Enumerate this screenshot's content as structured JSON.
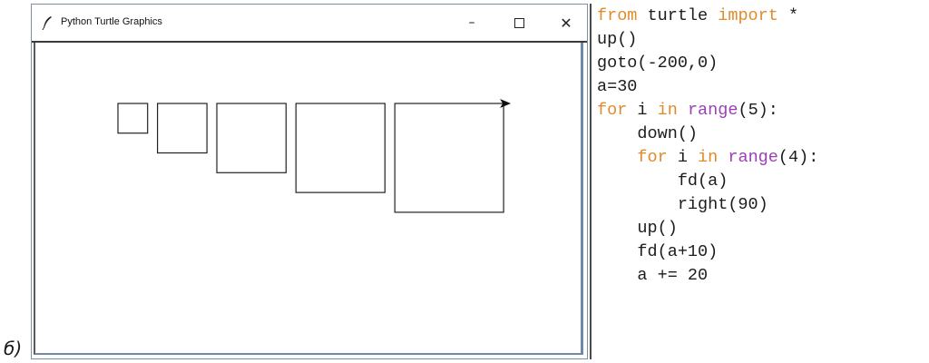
{
  "figure_label": "б)",
  "window": {
    "title": "Python Turtle Graphics",
    "feather_icon": "feather-icon",
    "minimize_label": "–",
    "close_label": "✕"
  },
  "squares": [
    {
      "side": 30
    },
    {
      "side": 50
    },
    {
      "side": 70
    },
    {
      "side": 90
    },
    {
      "side": 110
    }
  ],
  "colors": {
    "keyword": "#e08a2c",
    "builtin": "#9b3fb5",
    "text": "#1c1c1c",
    "window_border": "#7a8ea6"
  },
  "code": {
    "lines": [
      [
        {
          "t": "from",
          "c": "kw"
        },
        {
          "t": " turtle ",
          "c": ""
        },
        {
          "t": "import",
          "c": "kw"
        },
        {
          "t": " *",
          "c": ""
        }
      ],
      [
        {
          "t": "up()",
          "c": ""
        }
      ],
      [
        {
          "t": "goto(-200,0)",
          "c": ""
        }
      ],
      [
        {
          "t": "a=30",
          "c": ""
        }
      ],
      [
        {
          "t": "for",
          "c": "kw"
        },
        {
          "t": " i ",
          "c": ""
        },
        {
          "t": "in",
          "c": "kw"
        },
        {
          "t": " ",
          "c": ""
        },
        {
          "t": "range",
          "c": "bi"
        },
        {
          "t": "(5):",
          "c": ""
        }
      ],
      [
        {
          "t": "    down()",
          "c": ""
        }
      ],
      [
        {
          "t": "    ",
          "c": ""
        },
        {
          "t": "for",
          "c": "kw"
        },
        {
          "t": " i ",
          "c": ""
        },
        {
          "t": "in",
          "c": "kw"
        },
        {
          "t": " ",
          "c": ""
        },
        {
          "t": "range",
          "c": "bi"
        },
        {
          "t": "(4):",
          "c": ""
        }
      ],
      [
        {
          "t": "        fd(a)",
          "c": ""
        }
      ],
      [
        {
          "t": "        right(90)",
          "c": ""
        }
      ],
      [
        {
          "t": "    up()",
          "c": ""
        }
      ],
      [
        {
          "t": "    fd(a+10)",
          "c": ""
        }
      ],
      [
        {
          "t": "    a += 20",
          "c": ""
        }
      ]
    ]
  }
}
